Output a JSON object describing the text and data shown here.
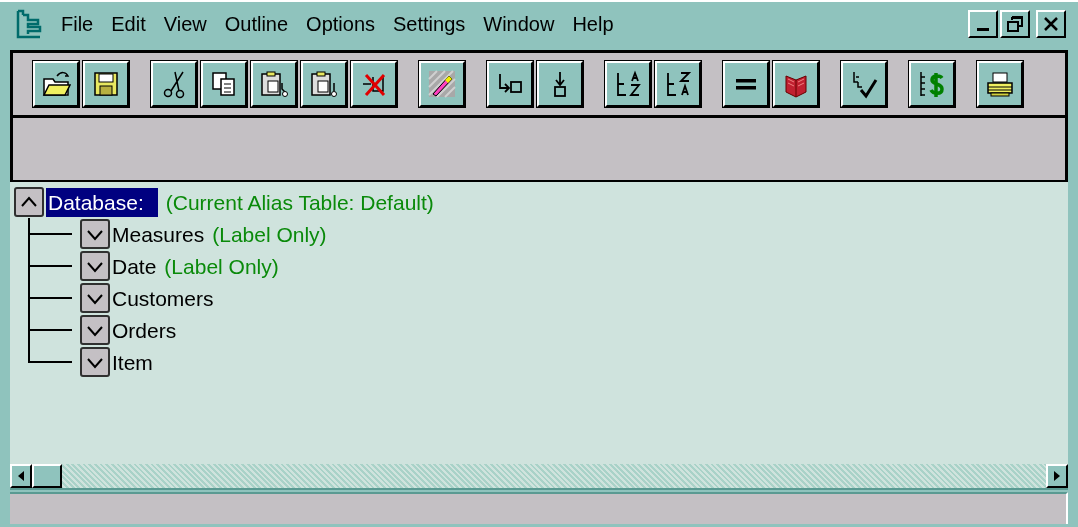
{
  "menu": [
    "File",
    "Edit",
    "View",
    "Outline",
    "Options",
    "Settings",
    "Window",
    "Help"
  ],
  "outline": {
    "label": "Database:",
    "note": "(Current Alias Table: Default)",
    "selected": true,
    "expanded": true,
    "children": [
      {
        "label": "Measures",
        "note": "(Label Only)",
        "selected": false,
        "expanded": false
      },
      {
        "label": "Date",
        "note": "(Label Only)",
        "selected": false,
        "expanded": false
      },
      {
        "label": "Customers",
        "selected": false,
        "expanded": false
      },
      {
        "label": "Orders",
        "selected": false,
        "expanded": false
      },
      {
        "label": "Item",
        "selected": false,
        "expanded": false
      }
    ]
  }
}
